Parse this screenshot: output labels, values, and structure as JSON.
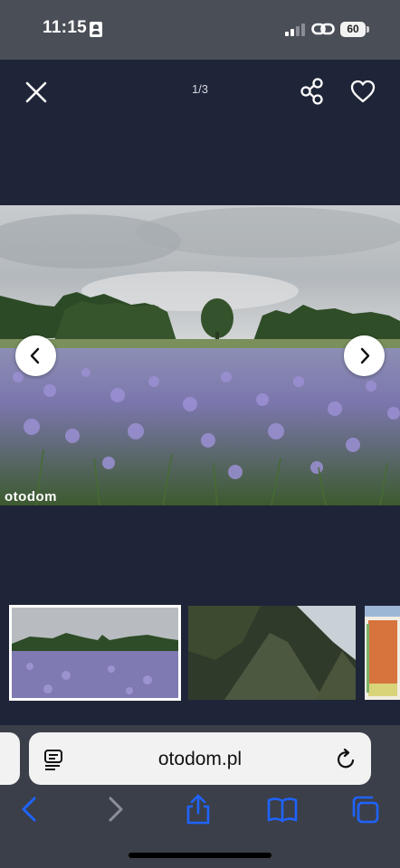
{
  "status_bar": {
    "time": "11:15",
    "battery": "60",
    "icons": [
      "id-card-icon",
      "signal-icon",
      "link-icon",
      "battery-icon"
    ]
  },
  "viewer": {
    "counter": "1/3",
    "watermark": "otodom",
    "buttons": [
      "close-icon",
      "share-icon",
      "heart-icon",
      "chevron-left-icon",
      "chevron-right-icon"
    ],
    "selected_thumbnail": 1
  },
  "browser": {
    "url": "otodom.pl",
    "toolbar": [
      "back-icon",
      "forward-icon",
      "share-icon",
      "bookmarks-icon",
      "tabs-icon"
    ]
  },
  "colors": {
    "viewer_bg": "#1f2538",
    "browser_accent": "#1f63ff",
    "disabled": "#8c8f96"
  }
}
